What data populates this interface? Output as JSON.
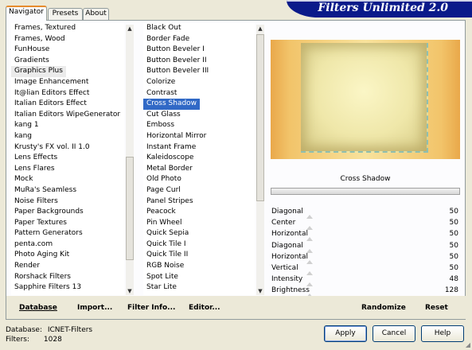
{
  "banner": {
    "title": "Filters Unlimited 2.0"
  },
  "tabs": [
    {
      "label": "Navigator",
      "active": true
    },
    {
      "label": "Presets",
      "active": false
    },
    {
      "label": "About",
      "active": false
    }
  ],
  "categories": [
    "Frames, Textured",
    "Frames, Wood",
    "FunHouse",
    "Gradients",
    "Graphics Plus",
    "Image Enhancement",
    "It@lian Editors Effect",
    "Italian Editors Effect",
    "Italian Editors WipeGenerator",
    "kang 1",
    "kang",
    "Krusty's FX vol. II 1.0",
    "Lens Effects",
    "Lens Flares",
    "Mock",
    "MuRa's Seamless",
    "Noise Filters",
    "Paper Backgrounds",
    "Paper Textures",
    "Pattern Generators",
    "penta.com",
    "Photo Aging Kit",
    "Render",
    "Rorshack Filters",
    "Sapphire Filters 13"
  ],
  "categories_selected": "Graphics Plus",
  "filters": [
    "Black Out",
    "Border Fade",
    "Button Beveler I",
    "Button Beveler II",
    "Button Beveler III",
    "Colorize",
    "Contrast",
    "Cross Shadow",
    "Cut Glass",
    "Emboss",
    "Horizontal Mirror",
    "Instant Frame",
    "Kaleidoscope",
    "Metal Border",
    "Old Photo",
    "Page Curl",
    "Panel Stripes",
    "Peacock",
    "Pin Wheel",
    "Quick Sepia",
    "Quick Tile I",
    "Quick Tile II",
    "RGB Noise",
    "Spot Lite",
    "Star Lite"
  ],
  "filters_selected": "Cross Shadow",
  "filter_name": "Cross Shadow",
  "params": [
    {
      "label": "Diagonal",
      "value": "50"
    },
    {
      "label": "Center",
      "value": "50"
    },
    {
      "label": "Horizontal",
      "value": "50"
    },
    {
      "label": "Diagonal",
      "value": "50"
    },
    {
      "label": "Horizontal",
      "value": "50"
    },
    {
      "label": "Vertical",
      "value": "50"
    },
    {
      "label": "Intensity",
      "value": "48"
    },
    {
      "label": "Brightness",
      "value": "128"
    }
  ],
  "links": {
    "database": "Database",
    "import": "Import...",
    "filter_info": "Filter Info...",
    "editor": "Editor...",
    "randomize": "Randomize",
    "reset": "Reset"
  },
  "info": {
    "database_label": "Database:",
    "database_value": "ICNET-Filters",
    "filters_label": "Filters:",
    "filters_value": "1028"
  },
  "buttons": {
    "apply": "Apply",
    "cancel": "Cancel",
    "help": "Help"
  },
  "colors": {
    "banner": "#0a1a8a",
    "selection": "#3169c6",
    "tab_accent": "#e68b2c"
  }
}
